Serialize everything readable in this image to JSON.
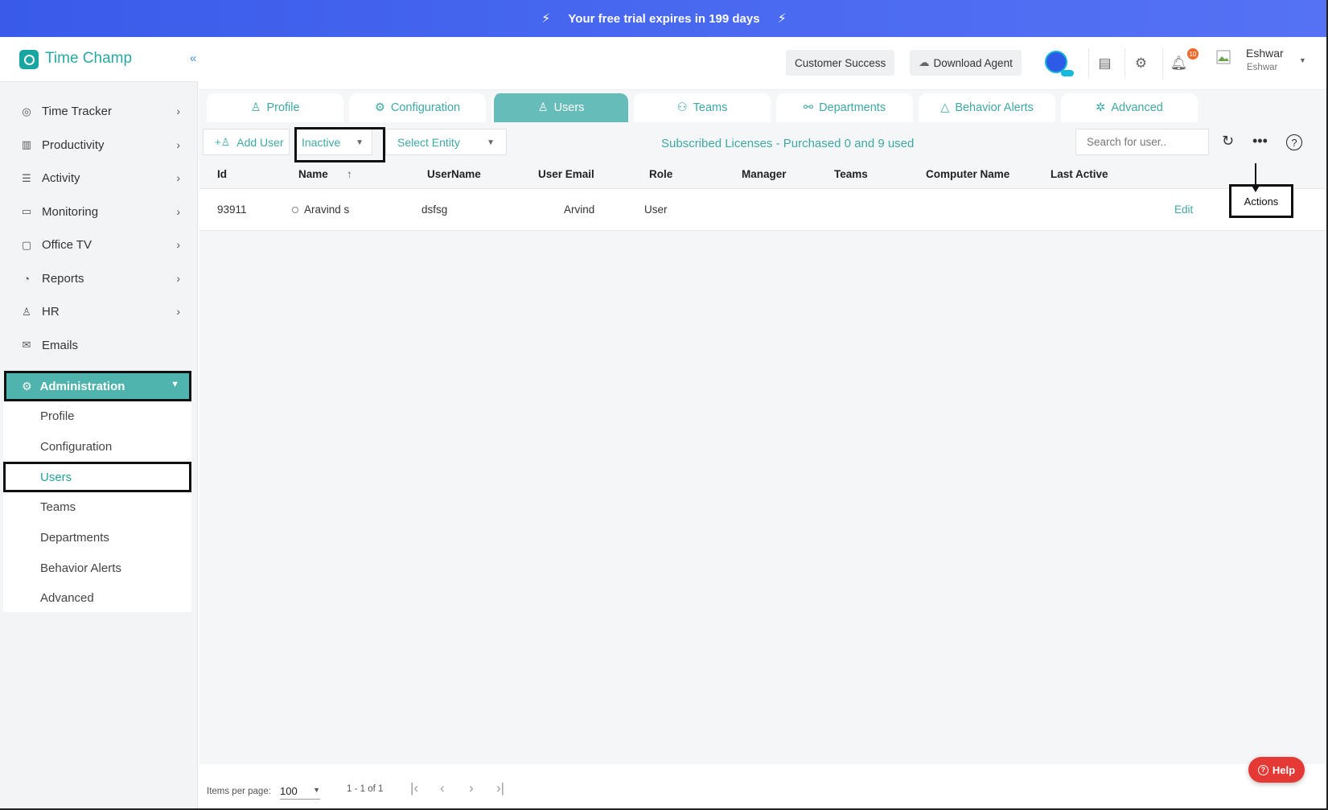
{
  "banner": {
    "text": "Your free trial expires in 199 days",
    "bolt": "⚡"
  },
  "brand": {
    "name": "Time Champ",
    "collapse_icon": "«"
  },
  "sidebar": {
    "items": [
      {
        "label": "Time Tracker",
        "icon": "timer-icon"
      },
      {
        "label": "Productivity",
        "icon": "chart-icon"
      },
      {
        "label": "Activity",
        "icon": "activity-icon"
      },
      {
        "label": "Monitoring",
        "icon": "monitor-icon"
      },
      {
        "label": "Office TV",
        "icon": "tv-icon"
      },
      {
        "label": "Reports",
        "icon": "pie-icon"
      },
      {
        "label": "HR",
        "icon": "person-icon"
      },
      {
        "label": "Emails",
        "icon": "mail-icon"
      }
    ],
    "admin_label": "Administration",
    "sub_items": [
      "Profile",
      "Configuration",
      "Users",
      "Teams",
      "Departments",
      "Behavior Alerts",
      "Advanced"
    ]
  },
  "header": {
    "customer_success": "Customer Success",
    "download_agent": "Download Agent",
    "notification_count": "10",
    "user_name": "Eshwar",
    "user_sub": "Eshwar"
  },
  "tabs": [
    "Profile",
    "Configuration",
    "Users",
    "Teams",
    "Departments",
    "Behavior Alerts",
    "Advanced"
  ],
  "toolbar": {
    "add_user": "Add User",
    "status_filter": "Inactive",
    "entity_filter": "Select Entity",
    "licenses": "Subscribed Licenses - Purchased 0 and 9 used",
    "search_placeholder": "Search for user.."
  },
  "table": {
    "headers": [
      "Id",
      "Name",
      "UserName",
      "User Email",
      "Role",
      "Manager",
      "Teams",
      "Computer Name",
      "Last Active"
    ],
    "rows": [
      {
        "id": "93911",
        "name": "Aravind s",
        "username": "dsfsg",
        "email": "Arvind",
        "role": "User",
        "edit": "Edit",
        "actions": "Actions"
      }
    ]
  },
  "pager": {
    "items_per_page_label": "Items per page:",
    "items_per_page": "100",
    "range": "1 - 1 of 1"
  },
  "help": {
    "label": "Help"
  },
  "colors": {
    "accent": "#3ea8a4",
    "banner": "#4868f0",
    "help": "#e53935"
  }
}
